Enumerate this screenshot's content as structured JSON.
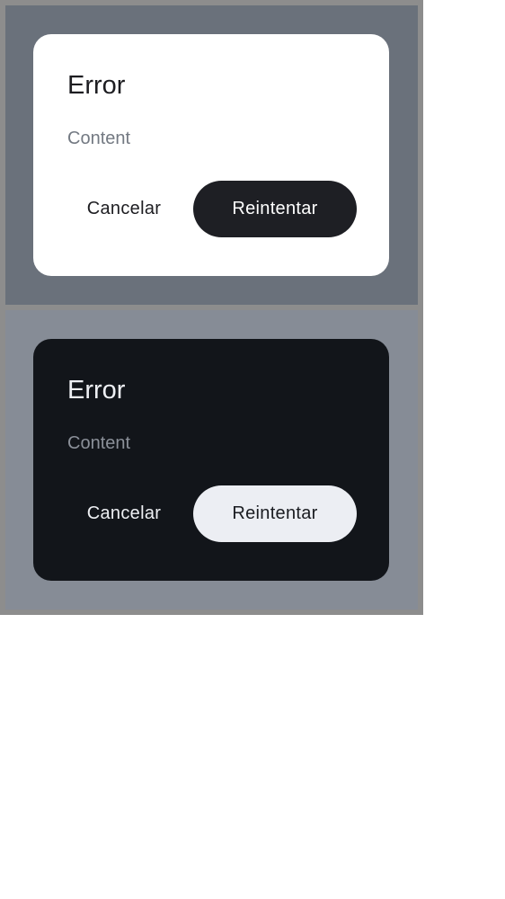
{
  "light_dialog": {
    "title": "Error",
    "content": "Content",
    "cancel_label": "Cancelar",
    "retry_label": "Reintentar"
  },
  "dark_dialog": {
    "title": "Error",
    "content": "Content",
    "cancel_label": "Cancelar",
    "retry_label": "Reintentar"
  },
  "colors": {
    "light_scrim": "#6a717b",
    "dark_scrim": "#868c96",
    "light_surface": "#ffffff",
    "dark_surface": "#12151a",
    "light_primary_button": "#1e1f24",
    "dark_primary_button": "#eceef3"
  }
}
